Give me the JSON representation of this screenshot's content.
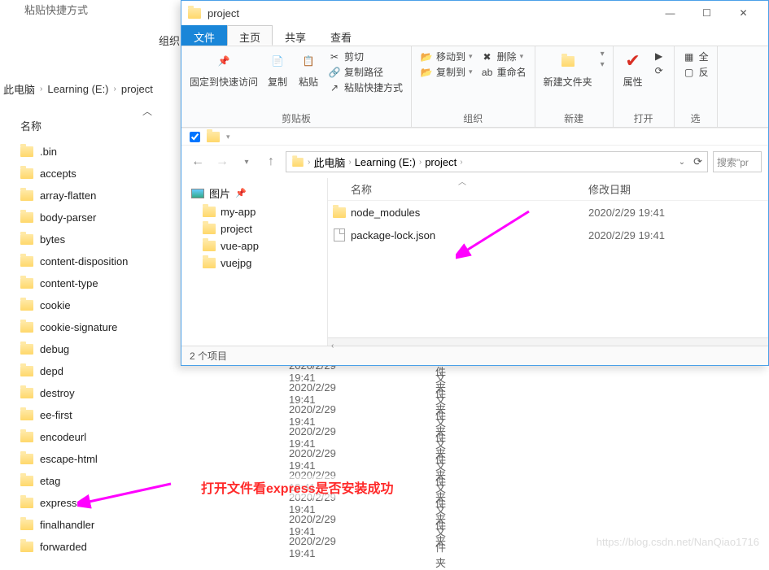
{
  "bg": {
    "title_partial": "粘贴快捷方式",
    "group_label": "组织",
    "breadcrumb": [
      "此电脑",
      "Learning (E:)",
      "project"
    ],
    "name_header": "名称",
    "collapse_icon": "︿",
    "folders": [
      ".bin",
      "accepts",
      "array-flatten",
      "body-parser",
      "bytes",
      "content-disposition",
      "content-type",
      "cookie",
      "cookie-signature",
      "debug",
      "depd",
      "destroy",
      "ee-first",
      "encodeurl",
      "escape-html",
      "etag",
      "express",
      "finalhandler",
      "forwarded"
    ],
    "date": "2020/2/29 19:41",
    "type": "文件夹"
  },
  "fg": {
    "title": "project",
    "tabs": {
      "file": "文件",
      "home": "主页",
      "share": "共享",
      "view": "查看"
    },
    "ribbon": {
      "pin": "固定到快速访问",
      "copy": "复制",
      "paste": "粘贴",
      "cut": "剪切",
      "copy_path": "复制路径",
      "paste_shortcut": "粘贴快捷方式",
      "clipboard_grp": "剪贴板",
      "move_to": "移动到",
      "copy_to": "复制到",
      "delete": "删除",
      "rename": "重命名",
      "org_grp": "组织",
      "new_folder": "新建文件夹",
      "new_grp": "新建",
      "properties": "属性",
      "open_grp": "打开",
      "select_all": "全",
      "select_grp": "选"
    },
    "nav": {
      "breadcrumb": [
        "此电脑",
        "Learning (E:)",
        "project"
      ]
    },
    "search_placeholder": "搜索\"pr",
    "tree": {
      "header": "图片",
      "items": [
        "my-app",
        "project",
        "vue-app",
        "vuejpg"
      ]
    },
    "list_headers": {
      "name": "名称",
      "date": "修改日期"
    },
    "items": [
      {
        "icon": "folder",
        "name": "node_modules",
        "date": "2020/2/29 19:41"
      },
      {
        "icon": "file",
        "name": "package-lock.json",
        "date": "2020/2/29 19:41"
      }
    ],
    "status": "2 个项目"
  },
  "annotation": "打开文件看express是否安装成功",
  "watermark": "https://blog.csdn.net/NanQiao1716"
}
